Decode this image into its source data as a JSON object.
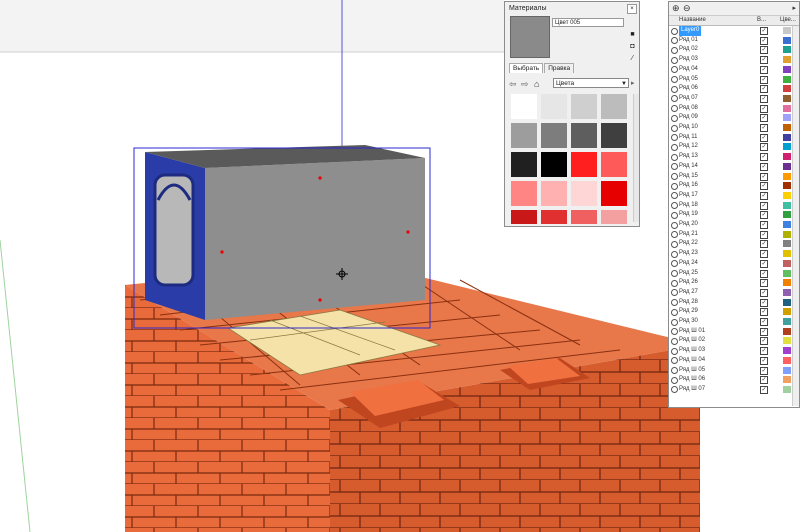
{
  "materials_panel": {
    "title": "Материалы",
    "close_glyph": "×",
    "material_name": "Цвет 005",
    "tabs": [
      "Выбрать",
      "Правка"
    ],
    "collection": "Цвета",
    "swatch_colors": [
      "#ffffff",
      "#e6e6e6",
      "#cfcfcf",
      "#bcbcbc",
      "#9d9d9d",
      "#7d7d7d",
      "#5e5e5e",
      "#3f3f3f",
      "#202020",
      "#000000",
      "#ff1f1f",
      "#ff5a5a",
      "#ff8585",
      "#ffb1b1",
      "#ffd6d6",
      "#e60000",
      "#c81818",
      "#e03030",
      "#f06060",
      "#f5a0a0"
    ]
  },
  "layers_panel": {
    "add_glyph": "⊕",
    "remove_glyph": "⊖",
    "columns": {
      "name": "Название",
      "visible": "В...",
      "color": "Цве..."
    },
    "layers": [
      {
        "name": "Layer0",
        "color": "#c8c8c8",
        "selected": true
      },
      {
        "name": "Ряд 01",
        "color": "#3a6fd1"
      },
      {
        "name": "Ряд 02",
        "color": "#20a090"
      },
      {
        "name": "Ряд 03",
        "color": "#e0a030"
      },
      {
        "name": "Ряд 04",
        "color": "#8040c0"
      },
      {
        "name": "Ряд 05",
        "color": "#40b040"
      },
      {
        "name": "Ряд 06",
        "color": "#d04040"
      },
      {
        "name": "Ряд 07",
        "color": "#906030"
      },
      {
        "name": "Ряд 08",
        "color": "#e070a0"
      },
      {
        "name": "Ряд 09",
        "color": "#a0a0ff"
      },
      {
        "name": "Ряд 10",
        "color": "#c06000"
      },
      {
        "name": "Ряд 11",
        "color": "#4040a0"
      },
      {
        "name": "Ряд 12",
        "color": "#00a0d0"
      },
      {
        "name": "Ряд 13",
        "color": "#d02070"
      },
      {
        "name": "Ряд 14",
        "color": "#6a3090"
      },
      {
        "name": "Ряд 15",
        "color": "#ff9900"
      },
      {
        "name": "Ряд 16",
        "color": "#a03000"
      },
      {
        "name": "Ряд 17",
        "color": "#ffd000"
      },
      {
        "name": "Ряд 18",
        "color": "#40c0a0"
      },
      {
        "name": "Ряд 19",
        "color": "#30a040"
      },
      {
        "name": "Ряд 20",
        "color": "#4080e0"
      },
      {
        "name": "Ряд 21",
        "color": "#b0b000"
      },
      {
        "name": "Ряд 22",
        "color": "#808080"
      },
      {
        "name": "Ряд 23",
        "color": "#e0c000"
      },
      {
        "name": "Ряд 24",
        "color": "#c06060"
      },
      {
        "name": "Ряд 25",
        "color": "#60c060"
      },
      {
        "name": "Ряд 26",
        "color": "#f08000"
      },
      {
        "name": "Ряд 27",
        "color": "#9060b0"
      },
      {
        "name": "Ряд 28",
        "color": "#206080"
      },
      {
        "name": "Ряд 29",
        "color": "#d0a000"
      },
      {
        "name": "Ряд 30",
        "color": "#40a0a0"
      },
      {
        "name": "Ряд Ш 01",
        "color": "#b04020"
      },
      {
        "name": "Ряд Ш 02",
        "color": "#e0e040"
      },
      {
        "name": "Ряд Ш 03",
        "color": "#a040d0"
      },
      {
        "name": "Ряд Ш 04",
        "color": "#ff6060"
      },
      {
        "name": "Ряд Ш 05",
        "color": "#80a0ff"
      },
      {
        "name": "Ряд Ш 06",
        "color": "#f0a060"
      },
      {
        "name": "Ряд Ш 07",
        "color": "#a0d0a0"
      }
    ]
  }
}
